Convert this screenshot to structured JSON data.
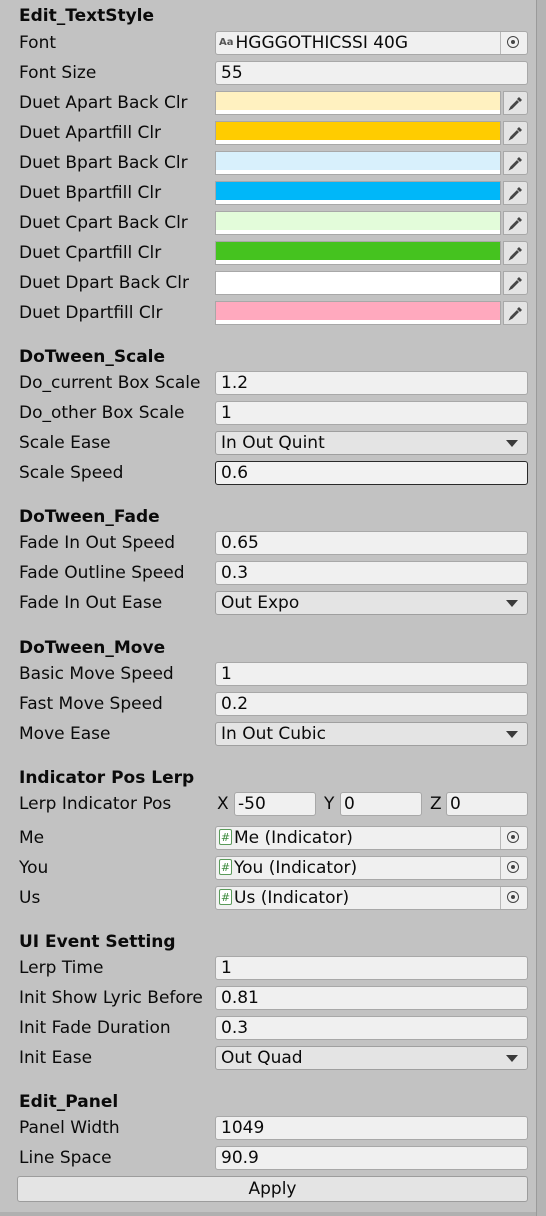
{
  "sections": {
    "text_style": {
      "header": "Edit_TextStyle",
      "font": {
        "label": "Font",
        "icon_text": "Aa",
        "value": "HGGGOTHICSSI 40G"
      },
      "font_size": {
        "label": "Font Size",
        "value": "55"
      },
      "colors": [
        {
          "label": "Duet Apart Back Clr",
          "color": "#fff1c0"
        },
        {
          "label": "Duet Apartfill Clr",
          "color": "#ffcc00"
        },
        {
          "label": "Duet Bpart Back Clr",
          "color": "#d8f0fc"
        },
        {
          "label": "Duet Bpartfill Clr",
          "color": "#00b7f9"
        },
        {
          "label": "Duet Cpart Back Clr",
          "color": "#e3fcda"
        },
        {
          "label": "Duet Cpartfill Clr",
          "color": "#45c31f"
        },
        {
          "label": "Duet Dpart Back Clr",
          "color": "#ffffff"
        },
        {
          "label": "Duet Dpartfill Clr",
          "color": "#ffa9be"
        }
      ]
    },
    "scale": {
      "header": "DoTween_Scale",
      "current_box_scale": {
        "label": "Do_current Box Scale",
        "value": "1.2"
      },
      "other_box_scale": {
        "label": "Do_other Box Scale",
        "value": "1"
      },
      "scale_ease": {
        "label": "Scale Ease",
        "value": "In Out Quint"
      },
      "scale_speed": {
        "label": "Scale Speed",
        "value": "0.6"
      }
    },
    "fade": {
      "header": "DoTween_Fade",
      "fade_in_out_speed": {
        "label": "Fade In Out Speed",
        "value": "0.65"
      },
      "fade_outline_speed": {
        "label": "Fade Outline Speed",
        "value": "0.3"
      },
      "fade_in_out_ease": {
        "label": "Fade In Out Ease",
        "value": "Out Expo"
      }
    },
    "move": {
      "header": "DoTween_Move",
      "basic_move_speed": {
        "label": "Basic Move Speed",
        "value": "1"
      },
      "fast_move_speed": {
        "label": "Fast Move Speed",
        "value": "0.2"
      },
      "move_ease": {
        "label": "Move Ease",
        "value": "In Out Cubic"
      }
    },
    "indicator": {
      "header": "Indicator Pos Lerp",
      "lerp_pos": {
        "label": "Lerp Indicator Pos",
        "x_label": "X",
        "x": "-50",
        "y_label": "Y",
        "y": "0",
        "z_label": "Z",
        "z": "0"
      },
      "me": {
        "label": "Me",
        "icon_text": "#",
        "value": "Me (Indicator)"
      },
      "you": {
        "label": "You",
        "icon_text": "#",
        "value": "You (Indicator)"
      },
      "us": {
        "label": "Us",
        "icon_text": "#",
        "value": "Us (Indicator)"
      }
    },
    "ui_event": {
      "header": "UI Event Setting",
      "lerp_time": {
        "label": "Lerp Time",
        "value": "1"
      },
      "init_show_lyric_before": {
        "label": "Init Show Lyric Before",
        "value": "0.81"
      },
      "init_fade_duration": {
        "label": "Init Fade Duration",
        "value": "0.3"
      },
      "init_ease": {
        "label": "Init Ease",
        "value": "Out Quad"
      }
    },
    "panel": {
      "header": "Edit_Panel",
      "panel_width": {
        "label": "Panel Width",
        "value": "1049"
      },
      "line_space": {
        "label": "Line Space",
        "value": "90.9"
      }
    }
  },
  "apply_label": "Apply",
  "icons": {
    "picker": "target-icon",
    "eyedropper": "eyedropper-icon",
    "dropdown": "chevron-down-icon",
    "script": "script-icon"
  }
}
